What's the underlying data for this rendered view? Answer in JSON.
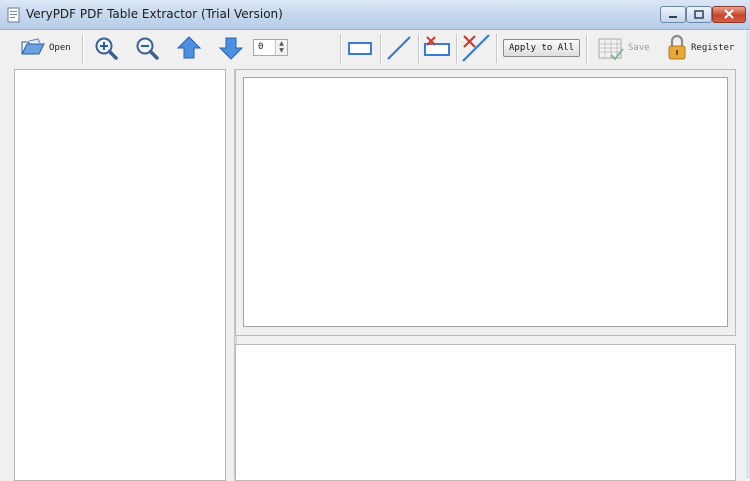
{
  "window": {
    "title": "VeryPDF PDF Table Extractor (Trial Version)",
    "controls": [
      "minimize",
      "maximize",
      "close"
    ]
  },
  "toolbar": {
    "open_label": "Open",
    "page_number": "0",
    "apply_label": "Apply to All",
    "save_label": "Save",
    "register_label": "Register",
    "icons": [
      "open-folder-icon",
      "zoom-in-icon",
      "zoom-out-icon",
      "page-up-icon",
      "page-down-icon",
      "draw-rectangle-icon",
      "draw-line-icon",
      "delete-rectangle-icon",
      "delete-line-icon",
      "save-icon",
      "register-lock-icon"
    ]
  },
  "colors": {
    "titlebar": "#c7d8ee",
    "accent_blue": "#2f6fd0",
    "delete_red": "#d23a2a",
    "panel_bg": "#ffffff"
  }
}
